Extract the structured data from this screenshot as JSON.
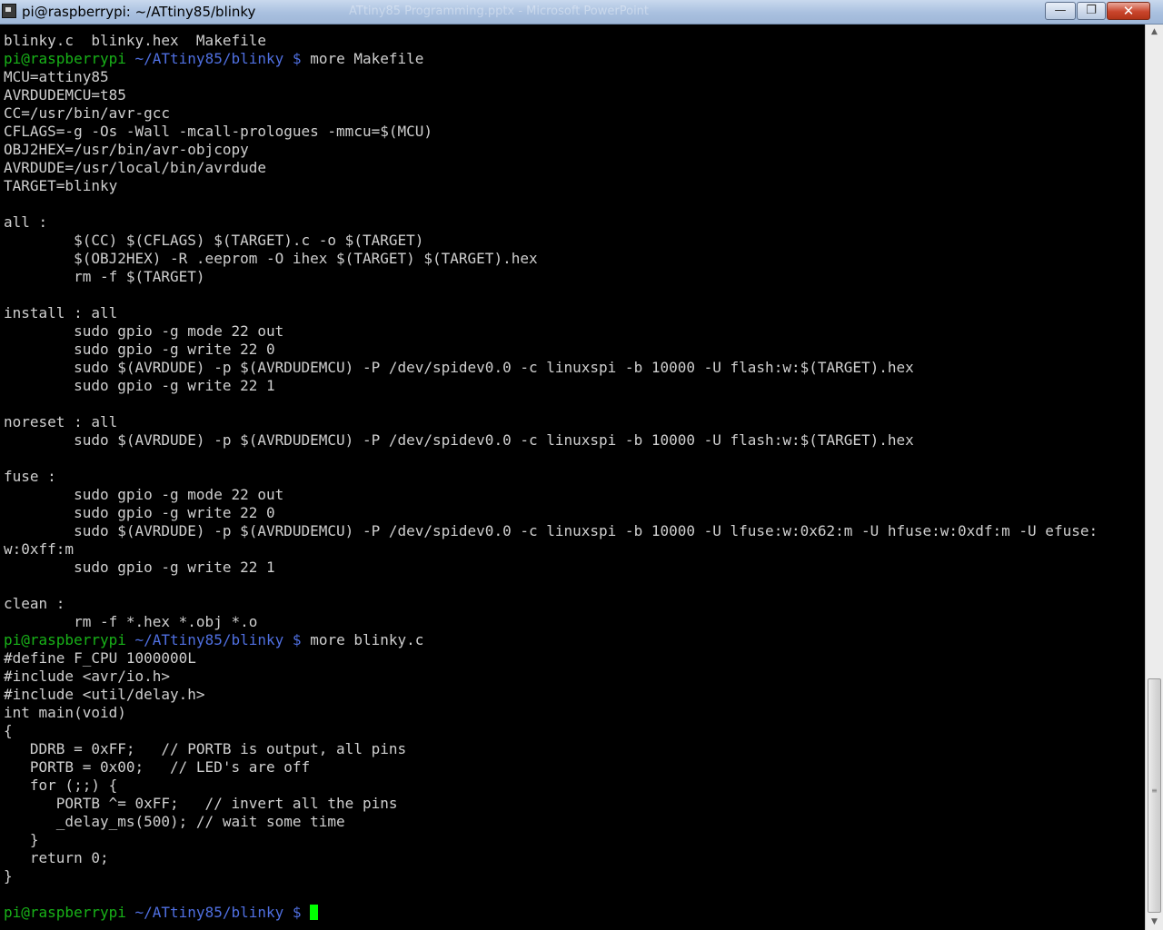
{
  "window": {
    "title": "pi@raspberrypi: ~/ATtiny85/blinky",
    "background_window_title": "ATtiny85 Programming.pptx - Microsoft PowerPoint",
    "controls": {
      "minimize": "—",
      "maximize": "❐",
      "close": "✕"
    }
  },
  "terminal": {
    "colors": {
      "prompt": "#18b218",
      "path": "#4f6fe0",
      "text": "#cfcfcf",
      "cursor": "#00ff00"
    },
    "prompt": {
      "user": "pi@raspberrypi",
      "path": "~/ATtiny85/blinky",
      "symbol": "$"
    },
    "lines": [
      "blinky.c  blinky.hex  Makefile",
      {
        "cmd": "more Makefile"
      },
      "MCU=attiny85",
      "AVRDUDEMCU=t85",
      "CC=/usr/bin/avr-gcc",
      "CFLAGS=-g -Os -Wall -mcall-prologues -mmcu=$(MCU)",
      "OBJ2HEX=/usr/bin/avr-objcopy",
      "AVRDUDE=/usr/local/bin/avrdude",
      "TARGET=blinky",
      "",
      "all :",
      "        $(CC) $(CFLAGS) $(TARGET).c -o $(TARGET)",
      "        $(OBJ2HEX) -R .eeprom -O ihex $(TARGET) $(TARGET).hex",
      "        rm -f $(TARGET)",
      "",
      "install : all",
      "        sudo gpio -g mode 22 out",
      "        sudo gpio -g write 22 0",
      "        sudo $(AVRDUDE) -p $(AVRDUDEMCU) -P /dev/spidev0.0 -c linuxspi -b 10000 -U flash:w:$(TARGET).hex",
      "        sudo gpio -g write 22 1",
      "",
      "noreset : all",
      "        sudo $(AVRDUDE) -p $(AVRDUDEMCU) -P /dev/spidev0.0 -c linuxspi -b 10000 -U flash:w:$(TARGET).hex",
      "",
      "fuse :",
      "        sudo gpio -g mode 22 out",
      "        sudo gpio -g write 22 0",
      "        sudo $(AVRDUDE) -p $(AVRDUDEMCU) -P /dev/spidev0.0 -c linuxspi -b 10000 -U lfuse:w:0x62:m -U hfuse:w:0xdf:m -U efuse:",
      "w:0xff:m",
      "        sudo gpio -g write 22 1",
      "",
      "clean :",
      "        rm -f *.hex *.obj *.o",
      {
        "cmd": "more blinky.c"
      },
      "#define F_CPU 1000000L",
      "#include <avr/io.h>",
      "#include <util/delay.h>",
      "int main(void)",
      "{",
      "   DDRB = 0xFF;   // PORTB is output, all pins",
      "   PORTB = 0x00;   // LED's are off",
      "   for (;;) {",
      "      PORTB ^= 0xFF;   // invert all the pins",
      "      _delay_ms(500); // wait some time",
      "   }",
      "   return 0;",
      "}",
      "",
      {
        "cmd": "",
        "cursor": true
      }
    ]
  },
  "scrollbar": {
    "up_arrow": "▲",
    "down_arrow": "▼",
    "thumb_grip": "≡"
  }
}
